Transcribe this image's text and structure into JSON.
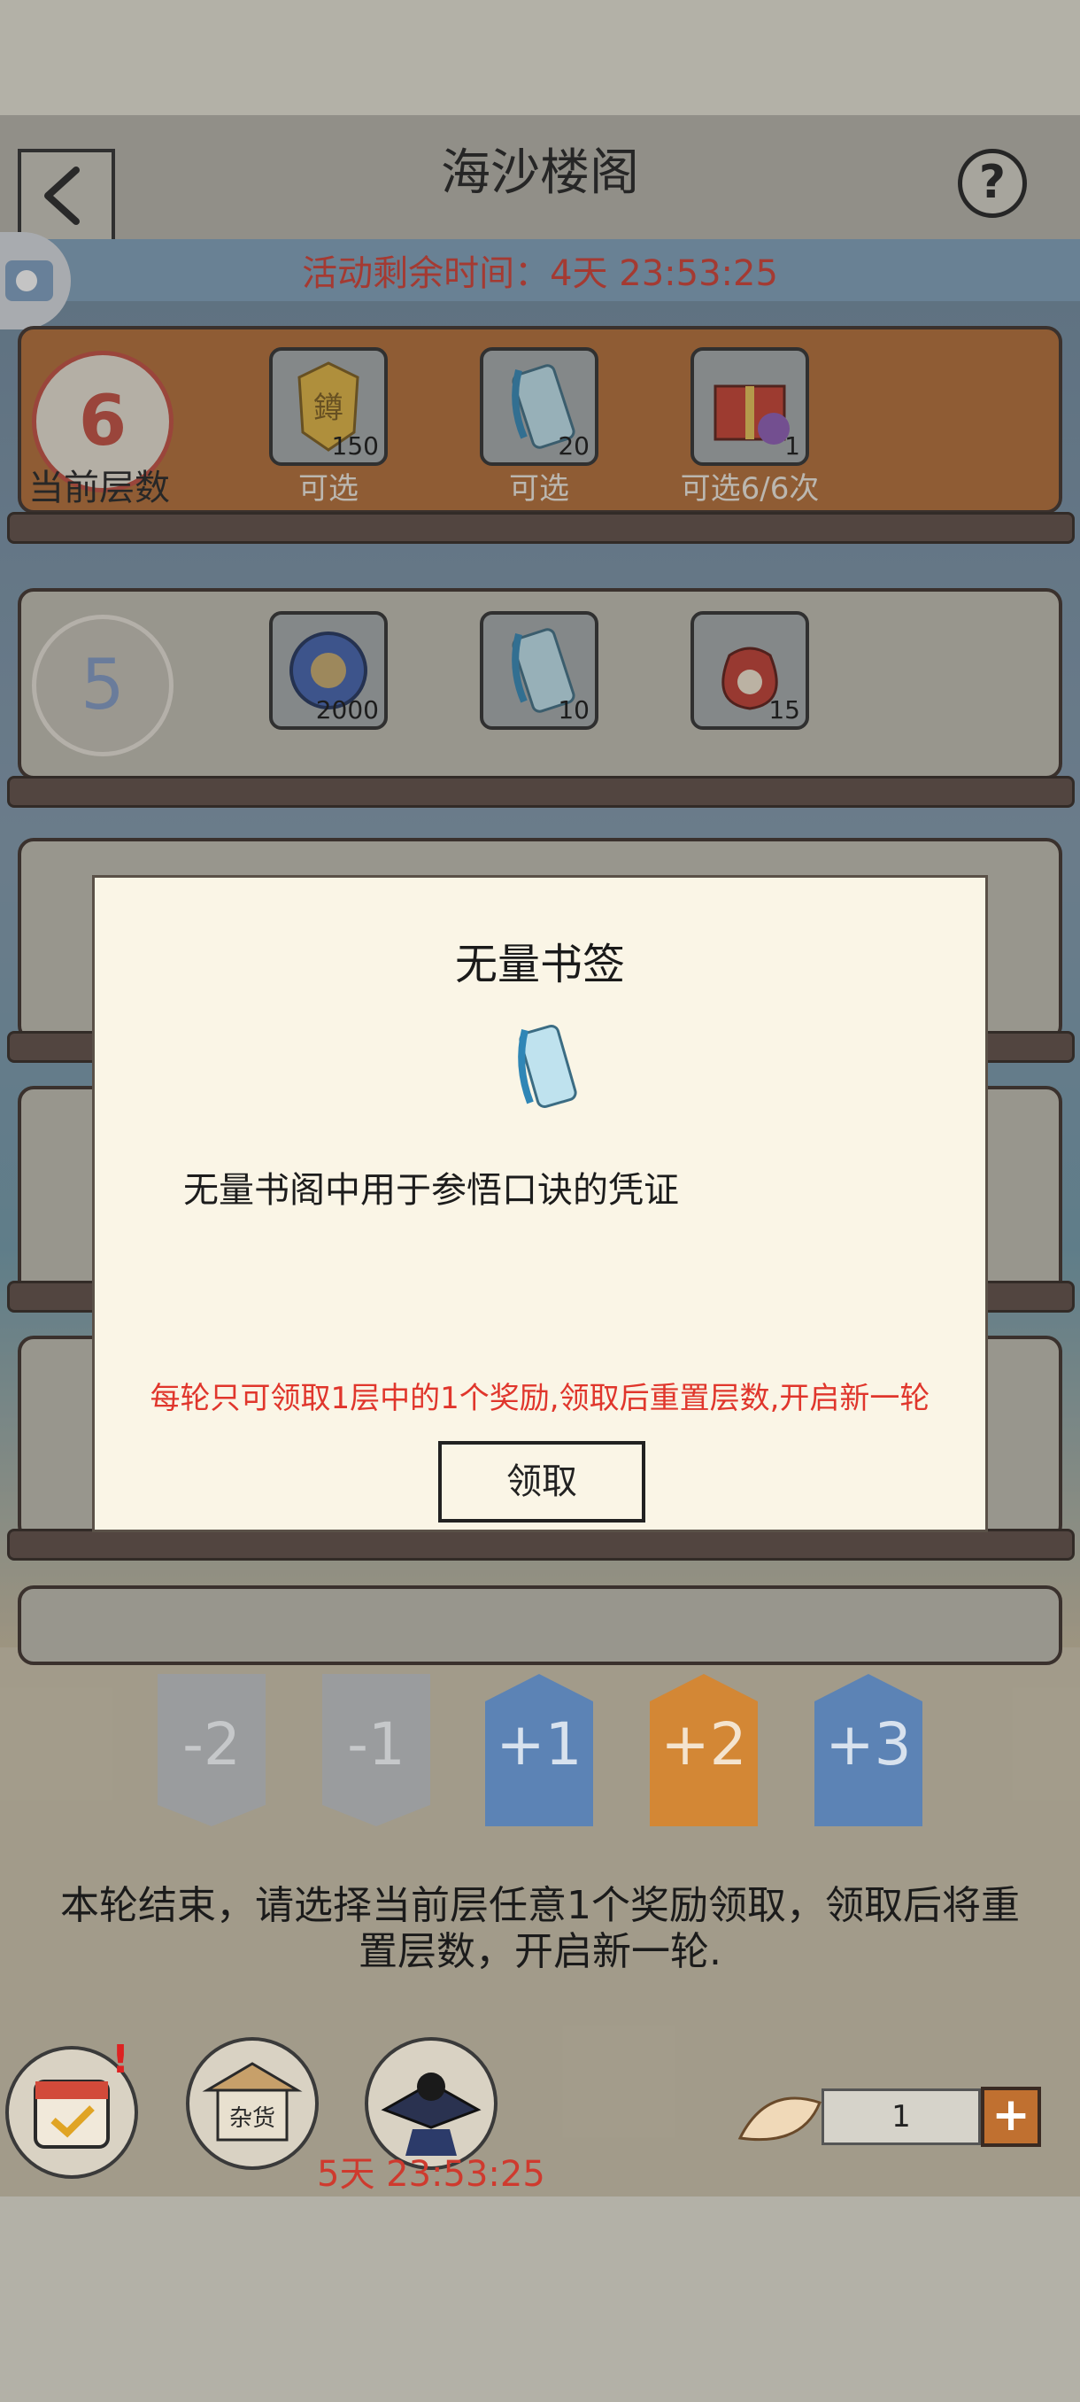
{
  "header": {
    "title": "海沙楼阁",
    "help_label": "?"
  },
  "event": {
    "timer_text": "活动剩余时间：4天 23:53:25"
  },
  "current_floor": {
    "number": "6",
    "label": "当前层数",
    "rewards": [
      {
        "icon": "gold-token-icon",
        "count": "150",
        "note": "可选"
      },
      {
        "icon": "bookmark-tag-icon",
        "count": "20",
        "note": "可选"
      },
      {
        "icon": "gift-box-icon",
        "count": "1",
        "note": "可选6/6次"
      }
    ]
  },
  "floor5": {
    "number": "5",
    "rewards": [
      {
        "icon": "blue-coin-icon",
        "count": "2000"
      },
      {
        "icon": "bookmark-tag-icon",
        "count": "10"
      },
      {
        "icon": "money-bag-icon",
        "count": "15"
      }
    ]
  },
  "modal": {
    "title": "无量书签",
    "icon": "bookmark-tag-icon",
    "description": "无量书阁中用于参悟口诀的凭证",
    "rule": "每轮只可领取1层中的1个奖励,领取后重置层数,开启新一轮",
    "claim_label": "领取"
  },
  "steps": [
    "-2",
    "-1",
    "+1",
    "+2",
    "+3"
  ],
  "end_message": "本轮结束，请选择当前层任意1个奖励领取，领取后将重置层数，开启新一轮.",
  "bottom": {
    "timer_text": "5天 23:53:25",
    "shell_count": "1",
    "shop_label": "杂货",
    "plus_label": "+"
  }
}
